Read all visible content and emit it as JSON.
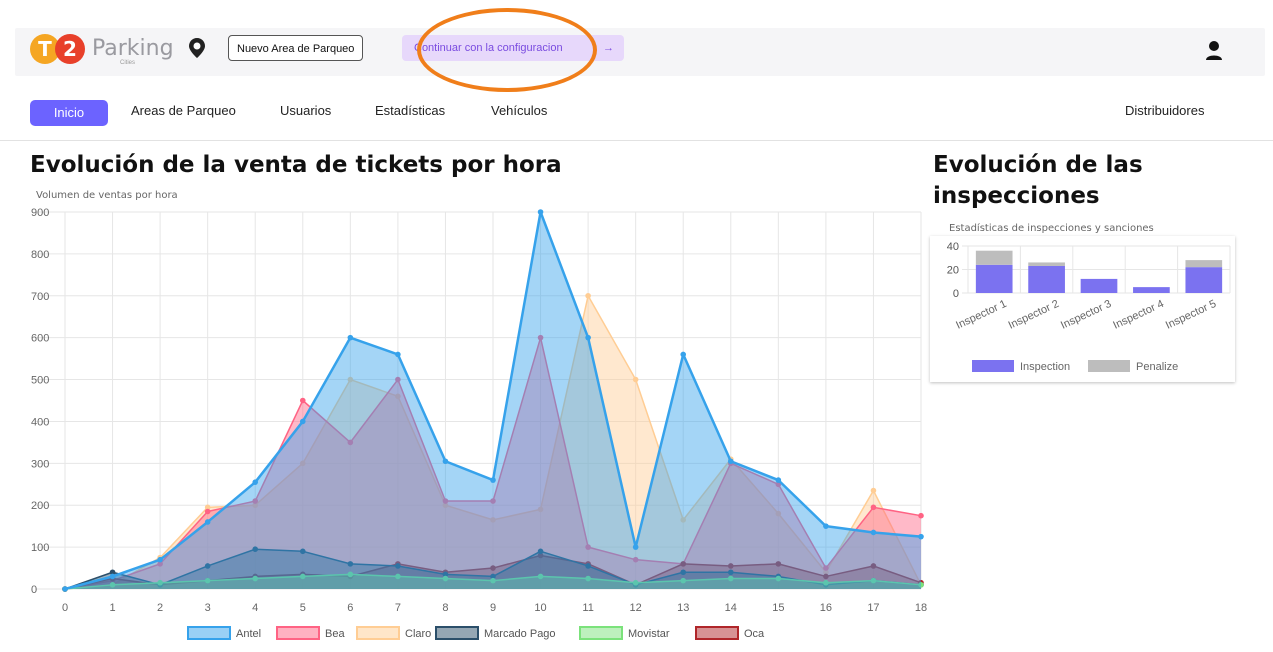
{
  "header": {
    "logo_letter_1": "T",
    "logo_letter_2": "2",
    "logo_text": "Parking",
    "logo_sub": "Cities",
    "new_area_button": "Nuevo Area de Parqueo",
    "continue_button": "Continuar con la configuracion",
    "continue_arrow": "→",
    "colors": {
      "logo_orange": "#f5a623",
      "logo_red": "#e8402a",
      "accent_purple": "#6c63ff",
      "highlight_orange": "#f07e1a"
    },
    "icons": [
      "location-pin-icon",
      "user-icon"
    ]
  },
  "nav": {
    "items": [
      "Inicio",
      "Areas de Parqueo",
      "Usuarios",
      "Estadísticas",
      "Vehículos"
    ],
    "active": "Inicio",
    "right_item": "Distribuidores"
  },
  "main_chart": {
    "heading": "Evolución de la venta de tickets por hora"
  },
  "side_chart": {
    "heading_line1": "Evolución de las",
    "heading_line2": "inspecciones"
  },
  "chart_data": [
    {
      "type": "area",
      "title": "Volumen de ventas por hora",
      "xlabel": "",
      "ylabel": "",
      "x": [
        0,
        1,
        2,
        3,
        4,
        5,
        6,
        7,
        8,
        9,
        10,
        11,
        12,
        13,
        14,
        15,
        16,
        17,
        18
      ],
      "ylim": [
        0,
        900
      ],
      "yticks": [
        0,
        100,
        200,
        300,
        400,
        500,
        600,
        700,
        800,
        900
      ],
      "grid": true,
      "legend_position": "bottom",
      "series": [
        {
          "name": "Antel",
          "color": "#36a2eb",
          "values": [
            0,
            30,
            70,
            160,
            255,
            400,
            600,
            560,
            305,
            260,
            900,
            600,
            100,
            560,
            305,
            260,
            150,
            135,
            125
          ]
        },
        {
          "name": "Bea",
          "color": "#ff6384",
          "values": [
            0,
            20,
            60,
            185,
            210,
            450,
            350,
            500,
            210,
            210,
            600,
            100,
            70,
            60,
            300,
            250,
            50,
            195,
            175
          ]
        },
        {
          "name": "Claro",
          "color": "#ffcd94",
          "values": [
            0,
            10,
            75,
            195,
            200,
            300,
            500,
            460,
            200,
            165,
            190,
            700,
            500,
            165,
            310,
            180,
            40,
            235,
            10
          ]
        },
        {
          "name": "Marcado Pago",
          "color": "#2b4f6a",
          "values": [
            0,
            40,
            10,
            55,
            95,
            90,
            60,
            55,
            35,
            30,
            90,
            55,
            10,
            40,
            40,
            30,
            10,
            20,
            10
          ]
        },
        {
          "name": "Movistar",
          "color": "#7be27b",
          "values": [
            0,
            10,
            15,
            20,
            25,
            30,
            35,
            30,
            25,
            20,
            30,
            25,
            15,
            20,
            25,
            25,
            15,
            20,
            10
          ]
        },
        {
          "name": "Oca",
          "color": "#b0262a",
          "values": [
            0,
            25,
            10,
            20,
            30,
            35,
            30,
            60,
            40,
            50,
            80,
            60,
            10,
            60,
            55,
            60,
            30,
            55,
            15
          ]
        }
      ]
    },
    {
      "type": "bar",
      "title": "Estadísticas de inspecciones y sanciones",
      "xlabel": "",
      "ylabel": "",
      "categories": [
        "Inspector 1",
        "Inspector 2",
        "Inspector 3",
        "Inspector 4",
        "Inspector 5"
      ],
      "stacked": true,
      "ylim": [
        0,
        40
      ],
      "yticks": [
        0,
        20,
        40
      ],
      "legend_position": "bottom",
      "series": [
        {
          "name": "Inspection",
          "color": "#7b72f0",
          "values": [
            24,
            23,
            12,
            5,
            22
          ]
        },
        {
          "name": "Penalize",
          "color": "#bdbdbd",
          "values": [
            12,
            3,
            0,
            0,
            6
          ]
        }
      ]
    }
  ]
}
